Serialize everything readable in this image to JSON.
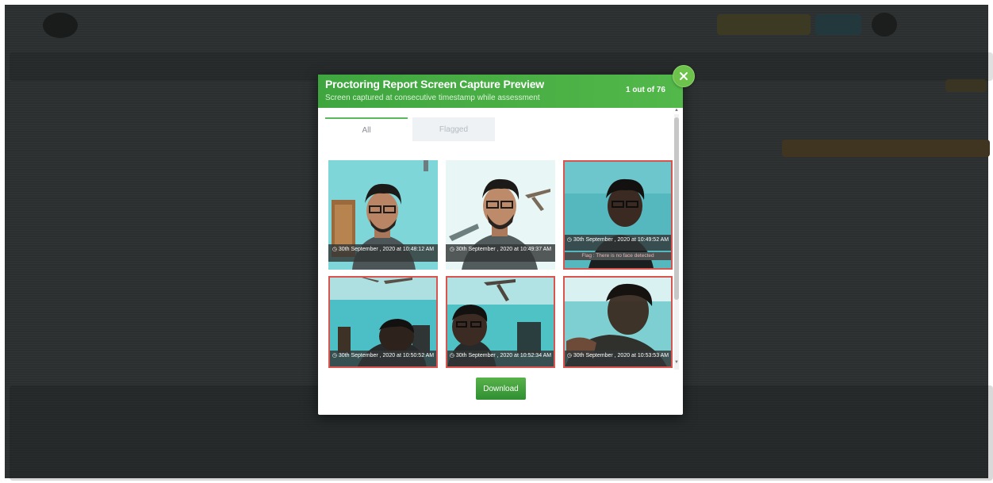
{
  "modal": {
    "title": "Proctoring Report Screen Capture Preview",
    "subtitle": "Screen captured at consecutive timestamp while assessment",
    "counter": "1 out of 76",
    "close_icon": "close-icon"
  },
  "tabs": [
    {
      "label": "All",
      "active": true
    },
    {
      "label": "Flagged",
      "active": false
    }
  ],
  "captures": [
    {
      "timestamp": "30th September , 2020 at 10:48:12 AM",
      "flagged": false,
      "flag_note": ""
    },
    {
      "timestamp": "30th September , 2020 at 10:49:37 AM",
      "flagged": false,
      "flag_note": ""
    },
    {
      "timestamp": "30th September , 2020 at 10:49:52 AM",
      "flagged": true,
      "flag_note": "Flag : There is no face detected"
    },
    {
      "timestamp": "30th September , 2020 at 10:50:52 AM",
      "flagged": true,
      "flag_note": ""
    },
    {
      "timestamp": "30th September , 2020 at 10:52:34 AM",
      "flagged": true,
      "flag_note": ""
    },
    {
      "timestamp": "30th September , 2020 at 10:53:53 AM",
      "flagged": true,
      "flag_note": ""
    }
  ],
  "footer": {
    "download_label": "Download"
  },
  "colors": {
    "header_green": "#4caf50",
    "flag_border": "#d9534f",
    "download_green": "#3a9b3a"
  }
}
